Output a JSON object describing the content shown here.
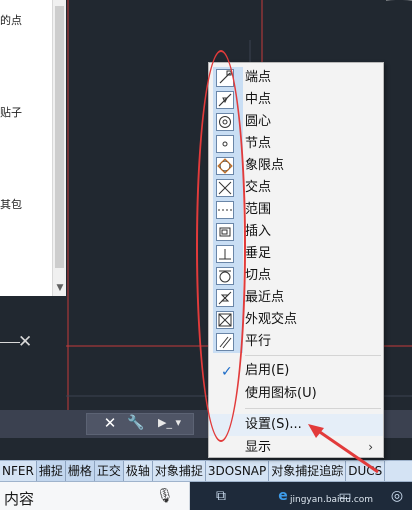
{
  "side_panel": {
    "lines": [
      "的点",
      "贴子",
      "其包"
    ]
  },
  "command_line": {
    "close_glyph": "✕",
    "wrench_glyph": "🔧",
    "prompt_glyph": "▶_ ▾"
  },
  "status_bar": {
    "buttons": [
      {
        "label": "NFER",
        "on": false
      },
      {
        "label": "捕捉",
        "on": true
      },
      {
        "label": "栅格",
        "on": true
      },
      {
        "label": "正交",
        "on": true
      },
      {
        "label": "极轴",
        "on": false
      },
      {
        "label": "对象捕捉",
        "on": false
      },
      {
        "label": "3DOSNAP",
        "on": false
      },
      {
        "label": "对象捕捉追踪",
        "on": false
      },
      {
        "label": "DUCS",
        "on": false
      }
    ]
  },
  "taskbar": {
    "search_text": "内容",
    "watermark": "jingyan.baidu.com"
  },
  "menu": {
    "snap_items": [
      {
        "label": "端点",
        "icon": "endpoint-icon"
      },
      {
        "label": "中点",
        "icon": "midpoint-icon"
      },
      {
        "label": "圆心",
        "icon": "center-icon"
      },
      {
        "label": "节点",
        "icon": "node-icon"
      },
      {
        "label": "象限点",
        "icon": "quadrant-icon"
      },
      {
        "label": "交点",
        "icon": "intersection-icon"
      },
      {
        "label": "范围",
        "icon": "extension-icon"
      },
      {
        "label": "插入",
        "icon": "insertion-icon"
      },
      {
        "label": "垂足",
        "icon": "perpendicular-icon"
      },
      {
        "label": "切点",
        "icon": "tangent-icon"
      },
      {
        "label": "最近点",
        "icon": "nearest-icon"
      },
      {
        "label": "外观交点",
        "icon": "apparent-intersection-icon"
      },
      {
        "label": "平行",
        "icon": "parallel-icon"
      }
    ],
    "enable_label": "启用(E)",
    "use_icons_label": "使用图标(U)",
    "settings_label": "设置(S)...",
    "display_label": "显示",
    "submenu_arrow": "›",
    "check_glyph": "✓"
  },
  "colors": {
    "canvas": "#212830",
    "menu_bg": "#f3f3f3",
    "icon_strip": "#c9def4",
    "annotation": "#e23b3b"
  }
}
